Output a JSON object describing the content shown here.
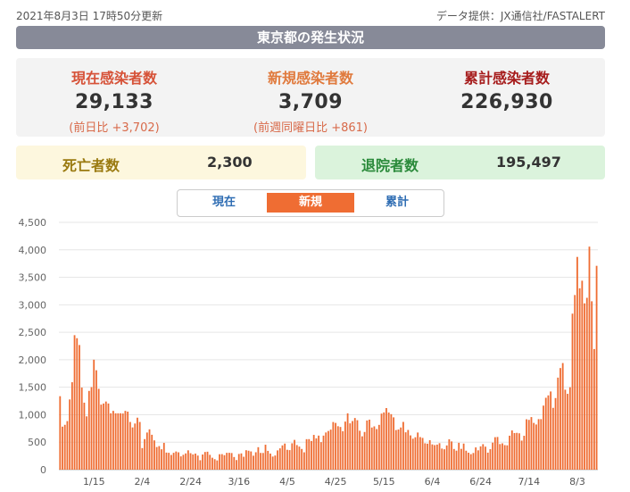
{
  "header": {
    "updated": "2021年8月3日 17時50分更新",
    "source": "データ提供：JX通信社/FASTALERT"
  },
  "banner": {
    "title": "東京都の発生状況"
  },
  "stats": {
    "current": {
      "label": "現在感染者数",
      "value": "29,133",
      "sub": "(前日比 +3,702)"
    },
    "new": {
      "label": "新規感染者数",
      "value": "3,709",
      "sub": "(前週同曜日比 +861)"
    },
    "total": {
      "label": "累計感染者数",
      "value": "226,930"
    }
  },
  "deaths": {
    "label": "死亡者数",
    "value": "2,300"
  },
  "recovered": {
    "label": "退院者数",
    "value": "195,497"
  },
  "tabs": [
    {
      "label": "現在",
      "active": false
    },
    {
      "label": "新規",
      "active": true
    },
    {
      "label": "累計",
      "active": false
    }
  ],
  "colors": {
    "bar": "#ef6d33",
    "accent": "#ef6d33",
    "link": "#2f6db3"
  },
  "chart_data": {
    "type": "bar",
    "ylim": [
      0,
      4500
    ],
    "yticks": [
      0,
      500,
      1000,
      1500,
      2000,
      2500,
      3000,
      3500,
      4000,
      4500
    ],
    "ytick_labels": [
      "0",
      "500",
      "1,000",
      "1,500",
      "2,000",
      "2,500",
      "3,000",
      "3,500",
      "4,000",
      "4,500"
    ],
    "xtick_labels": [
      "1/15",
      "2/4",
      "2/24",
      "3/16",
      "4/5",
      "4/25",
      "5/15",
      "6/4",
      "6/24",
      "7/14",
      "8/3"
    ],
    "xtick_index": [
      14,
      34,
      54,
      74,
      94,
      114,
      134,
      154,
      174,
      194,
      214
    ],
    "start_date": "2021-01-01",
    "values": [
      1337,
      783,
      816,
      884,
      1278,
      1591,
      2447,
      2392,
      2268,
      1494,
      1219,
      970,
      1433,
      1502,
      2001,
      1809,
      1471,
      1184,
      1204,
      1240,
      1204,
      1026,
      1070,
      1026,
      1026,
      1026,
      1022,
      1070,
      1056,
      868,
      769,
      840,
      946,
      868,
      393,
      556,
      676,
      734,
      635,
      533,
      412,
      429,
      371,
      488,
      311,
      307,
      268,
      307,
      331,
      316,
      242,
      271,
      296,
      352,
      300,
      278,
      293,
      257,
      172,
      276,
      322,
      327,
      270,
      217,
      191,
      168,
      281,
      283,
      264,
      307,
      307,
      303,
      230,
      175,
      286,
      296,
      235,
      354,
      345,
      332,
      254,
      317,
      409,
      305,
      304,
      454,
      342,
      293,
      239,
      258,
      351,
      388,
      442,
      475,
      362,
      356,
      480,
      542,
      448,
      420,
      377,
      316,
      555,
      556,
      522,
      633,
      570,
      620,
      501,
      620,
      677,
      704,
      729,
      867,
      851,
      791,
      777,
      700,
      875,
      1025,
      843,
      885,
      940,
      900,
      709,
      607,
      686,
      895,
      910,
      767,
      788,
      739,
      815,
      1020,
      1042,
      1121,
      1040,
      1010,
      952,
      721,
      731,
      768,
      869,
      680,
      723,
      624,
      564,
      590,
      676,
      593,
      578,
      480,
      473,
      536,
      460,
      447,
      456,
      482,
      384,
      371,
      441,
      553,
      514,
      377,
      346,
      489,
      379,
      475,
      345,
      309,
      282,
      304,
      405,
      352,
      424,
      464,
      419,
      310,
      373,
      492,
      591,
      595,
      466,
      479,
      447,
      443,
      618,
      714,
      666,
      670,
      662,
      529,
      617,
      917,
      906,
      957,
      851,
      822,
      920,
      920,
      1166,
      1308,
      1352,
      1423,
      1125,
      1303,
      1675,
      1849,
      1940,
      1455,
      1380,
      1500,
      2839,
      3178,
      3871,
      3300,
      3438,
      3026,
      3127,
      4058,
      3064,
      2195,
      3709
    ]
  }
}
